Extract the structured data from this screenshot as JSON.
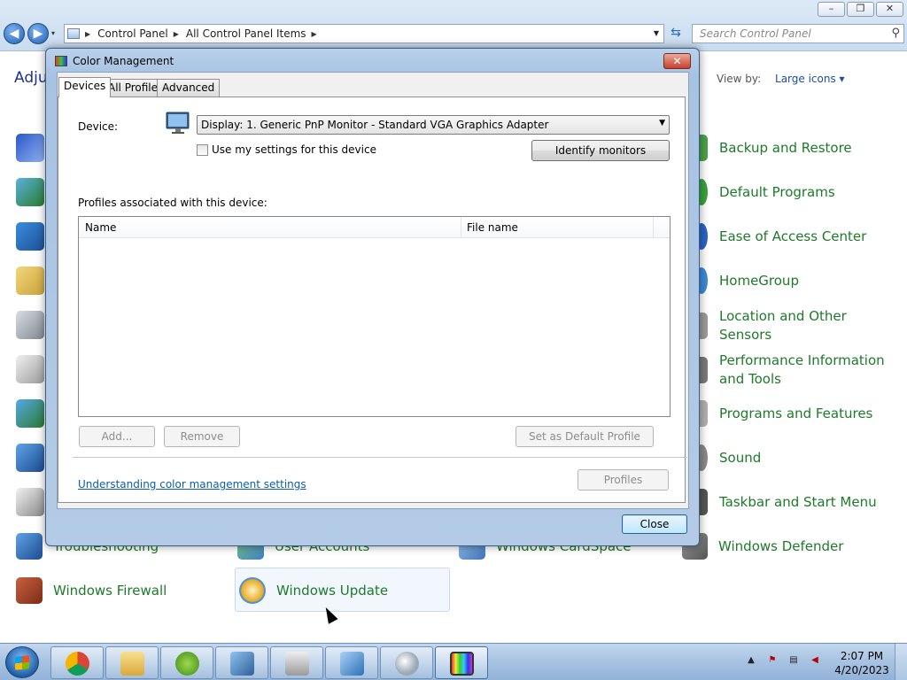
{
  "explorer": {
    "caption_buttons": {
      "minimize": "▭",
      "maximize": "▣",
      "close": "✕"
    },
    "nav": {
      "back": "◀",
      "forward": "▶",
      "recent": "▾"
    },
    "breadcrumb": [
      "Control Panel",
      "All Control Panel Items"
    ],
    "search_placeholder": "Search Control Panel"
  },
  "control_panel": {
    "title": "Adju",
    "view_by_label": "View by:",
    "view_by_value": "Large icons",
    "right_column": [
      {
        "label": "Backup and Restore",
        "icon": "backup-icon",
        "color": "#4aa04a"
      },
      {
        "label": "Default Programs",
        "icon": "default-programs-icon",
        "color": "#3aa23a"
      },
      {
        "label": "Ease of Access Center",
        "icon": "ease-of-access-icon",
        "color": "#2a64c4"
      },
      {
        "label": "HomeGroup",
        "icon": "homegroup-icon",
        "color": "#3c8ad8"
      },
      {
        "label": "Location and Other Sensors",
        "icon": "location-icon",
        "color": "#9a9a9a"
      },
      {
        "label": "Performance Information and Tools",
        "icon": "performance-icon",
        "color": "#7a7a7a"
      },
      {
        "label": "Programs and Features",
        "icon": "programs-icon",
        "color": "#b0b0b0"
      },
      {
        "label": "Sound",
        "icon": "sound-icon",
        "color": "#8a8a8a"
      },
      {
        "label": "Taskbar and Start Menu",
        "icon": "taskbar-icon",
        "color": "#555555"
      },
      {
        "label": "Windows Defender",
        "icon": "defender-icon",
        "color": "#6a6a6a"
      }
    ],
    "bottom_row_partial": [
      {
        "label": "Troubleshooting",
        "icon": "troubleshooting-icon"
      },
      {
        "label": "User Accounts",
        "icon": "user-accounts-icon"
      },
      {
        "label": "Windows CardSpace",
        "icon": "cardspace-icon"
      }
    ],
    "last_row": [
      {
        "label": "Windows Firewall",
        "icon": "firewall-icon",
        "color": "#b3492b"
      },
      {
        "label": "Windows Update",
        "icon": "windows-update-icon",
        "color": "#e6a81f"
      }
    ]
  },
  "dialog": {
    "title": "Color Management",
    "close_x": "✕",
    "tabs": [
      "Devices",
      "All Profiles",
      "Advanced"
    ],
    "device_label": "Device:",
    "device_value": "Display: 1. Generic PnP Monitor - Standard VGA Graphics Adapter",
    "use_settings_label": "Use my settings for this device",
    "identify_button": "Identify monitors",
    "profiles_assoc_label": "Profiles associated with this device:",
    "list_columns": [
      "Name",
      "File name"
    ],
    "add_button": "Add...",
    "remove_button": "Remove",
    "default_button": "Set as Default Profile",
    "help_link": "Understanding color management settings",
    "profiles_button": "Profiles",
    "close_button": "Close"
  },
  "taskbar": {
    "apps": [
      {
        "name": "chrome",
        "icon": "chrome-icon"
      },
      {
        "name": "explorer",
        "icon": "folder-icon"
      },
      {
        "name": "app",
        "icon": "peapod-icon"
      },
      {
        "name": "control-panel",
        "icon": "display-icon"
      },
      {
        "name": "fax",
        "icon": "printer-icon"
      },
      {
        "name": "settings",
        "icon": "control-panel-icon"
      },
      {
        "name": "search",
        "icon": "magnifier-icon"
      },
      {
        "name": "color-management",
        "icon": "color-monitor-icon"
      }
    ],
    "clock_time": "2:07 PM",
    "clock_date": "4/20/2023"
  }
}
